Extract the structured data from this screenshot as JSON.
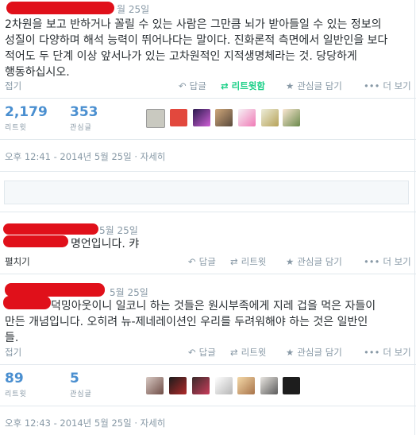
{
  "tweet1": {
    "date": "월 25일",
    "text_lines": [
      "2차원을 보고 반하거나 꼴릴 수 있는 사람은 그만큼 뇌가 받아들일 수 있는 정보의",
      "성질이 다양하며 해석 능력이 뛰어나다는 말이다. 진화론적 측면에서 일반인을 보다",
      "적어도 두 단계 이상 앞서나가 있는 고차원적인 지적생명체라는 것. 당당하게",
      "행동하십시오."
    ],
    "collapse_label": "접기",
    "actions": {
      "reply": "답글",
      "retweet": "리트윗함",
      "favorite": "관심글 담기",
      "more": "더 보기"
    },
    "stats": {
      "retweets": "2,179",
      "retweets_label": "리트윗",
      "favorites": "353",
      "favorites_label": "관심글"
    },
    "timestamp": "오후 12:41 - 2014년 5월 25일 · 자세히"
  },
  "reply1": {
    "date": "5월 25일",
    "text": "명언입니다. 캬",
    "expand_label": "펼치기",
    "actions": {
      "reply": "답글",
      "retweet": "리트윗",
      "favorite": "관심글 담기",
      "more": "더 보기"
    }
  },
  "tweet2": {
    "date": "5월 25일",
    "text_lines": [
      "덕밍아웃이니 일코니 하는 것들은 원시부족에게 지레 겁을 먹은 자들이",
      "만든 개념입니다. 오히려 뉴-제네레이션인 우리를 두려워해야 하는 것은 일반인",
      "들."
    ],
    "collapse_label": "접기",
    "actions": {
      "reply": "답글",
      "retweet": "리트윗",
      "favorite": "관심글 담기",
      "more": "더 보기"
    },
    "stats": {
      "retweets": "89",
      "retweets_label": "리트윗",
      "favorites": "5",
      "favorites_label": "관심글"
    },
    "timestamp": "오후 12:43 - 2014년 5월 25일 · 자세히"
  },
  "colors": {
    "accent": "#4a8fd0",
    "retweeted": "#19cf86",
    "muted": "#8899a6",
    "redaction": "#e0101a"
  },
  "icons": [
    "reply-icon",
    "retweet-icon",
    "star-icon",
    "more-dots-icon"
  ]
}
